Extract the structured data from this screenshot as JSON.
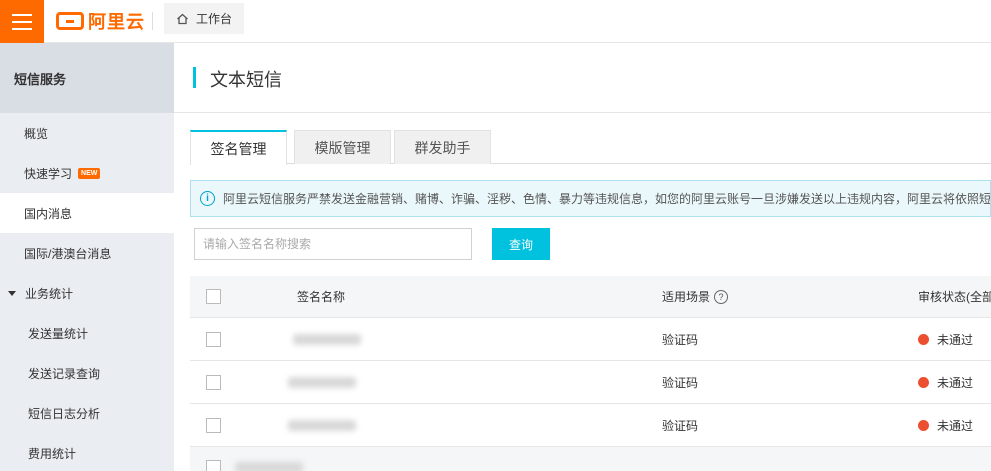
{
  "topbar": {
    "logo_text": "阿里云",
    "workbench_label": "工作台",
    "brand_color": "#ff6a00"
  },
  "sidebar": {
    "header": "短信服务",
    "items": [
      {
        "label": "概览"
      },
      {
        "label": "快速学习",
        "badge": "NEW"
      },
      {
        "label": "国内消息"
      },
      {
        "label": "国际/港澳台消息"
      },
      {
        "label": "业务统计"
      },
      {
        "label": "发送量统计"
      },
      {
        "label": "发送记录查询"
      },
      {
        "label": "短信日志分析"
      },
      {
        "label": "费用统计"
      }
    ]
  },
  "main": {
    "title": "文本短信",
    "accent_color": "#00c1de",
    "tabs": [
      {
        "label": "签名管理"
      },
      {
        "label": "模版管理"
      },
      {
        "label": "群发助手"
      }
    ],
    "notice": {
      "text": "阿里云短信服务严禁发送金融营销、赌博、诈骗、淫秽、色情、暴力等违规信息，如您的阿里云账号一旦涉嫌发送以上违规内容，阿里云将依照短"
    },
    "search": {
      "placeholder": "请输入签名名称搜索",
      "button_label": "查询"
    },
    "table": {
      "headers": {
        "name": "签名名称",
        "scene": "适用场景",
        "status": "审核状态(全部"
      },
      "rows": [
        {
          "scene": "验证码",
          "status": "未通过"
        },
        {
          "scene": "验证码",
          "status": "未通过"
        },
        {
          "scene": "验证码",
          "status": "未通过"
        }
      ],
      "status_color": "#ec4f2f"
    }
  }
}
